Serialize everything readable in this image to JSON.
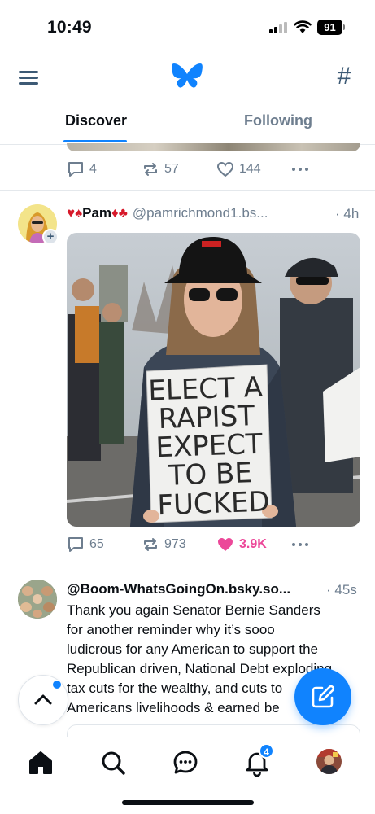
{
  "status_bar": {
    "time": "10:49",
    "battery": "91"
  },
  "header": {
    "menu_icon": "menu-icon",
    "logo_icon": "butterfly-logo-icon",
    "feeds_icon": "hashtag-icon"
  },
  "tabs": [
    {
      "label": "Discover",
      "active": true
    },
    {
      "label": "Following",
      "active": false
    }
  ],
  "prev_post": {
    "replies": "4",
    "reposts": "57",
    "likes": "144"
  },
  "post1": {
    "display_name_prefix": "♥♠",
    "display_name": "Pam",
    "display_name_suffix": "♦♣",
    "handle": "@pamrichmond1.bs...",
    "time": "· 4h",
    "image_sign_lines": [
      "ELECT A",
      "RAPIST",
      "EXPECT",
      "TO BE",
      "FUCKED"
    ],
    "replies": "65",
    "reposts": "973",
    "likes": "3.9K",
    "liked": true
  },
  "post2": {
    "handle": "@Boom-WhatsGoingOn.bsky.so...",
    "time": "· 45s",
    "text_lines": [
      "Thank you again Senator Bernie Sanders",
      "for another reminder why it’s sooo",
      "ludicrous for any American to support the",
      "Republican driven, National Debt exploding",
      "tax cuts for the wealthy, and cuts to",
      "Americans livelihoods & earned be"
    ]
  },
  "tab_bar": {
    "items": [
      "home-icon",
      "search-icon",
      "chat-icon",
      "bell-icon",
      "profile-avatar"
    ],
    "notification_count": "4"
  },
  "colors": {
    "accent": "#1083fe",
    "like": "#ec4899",
    "muted": "#6e7e8f"
  }
}
